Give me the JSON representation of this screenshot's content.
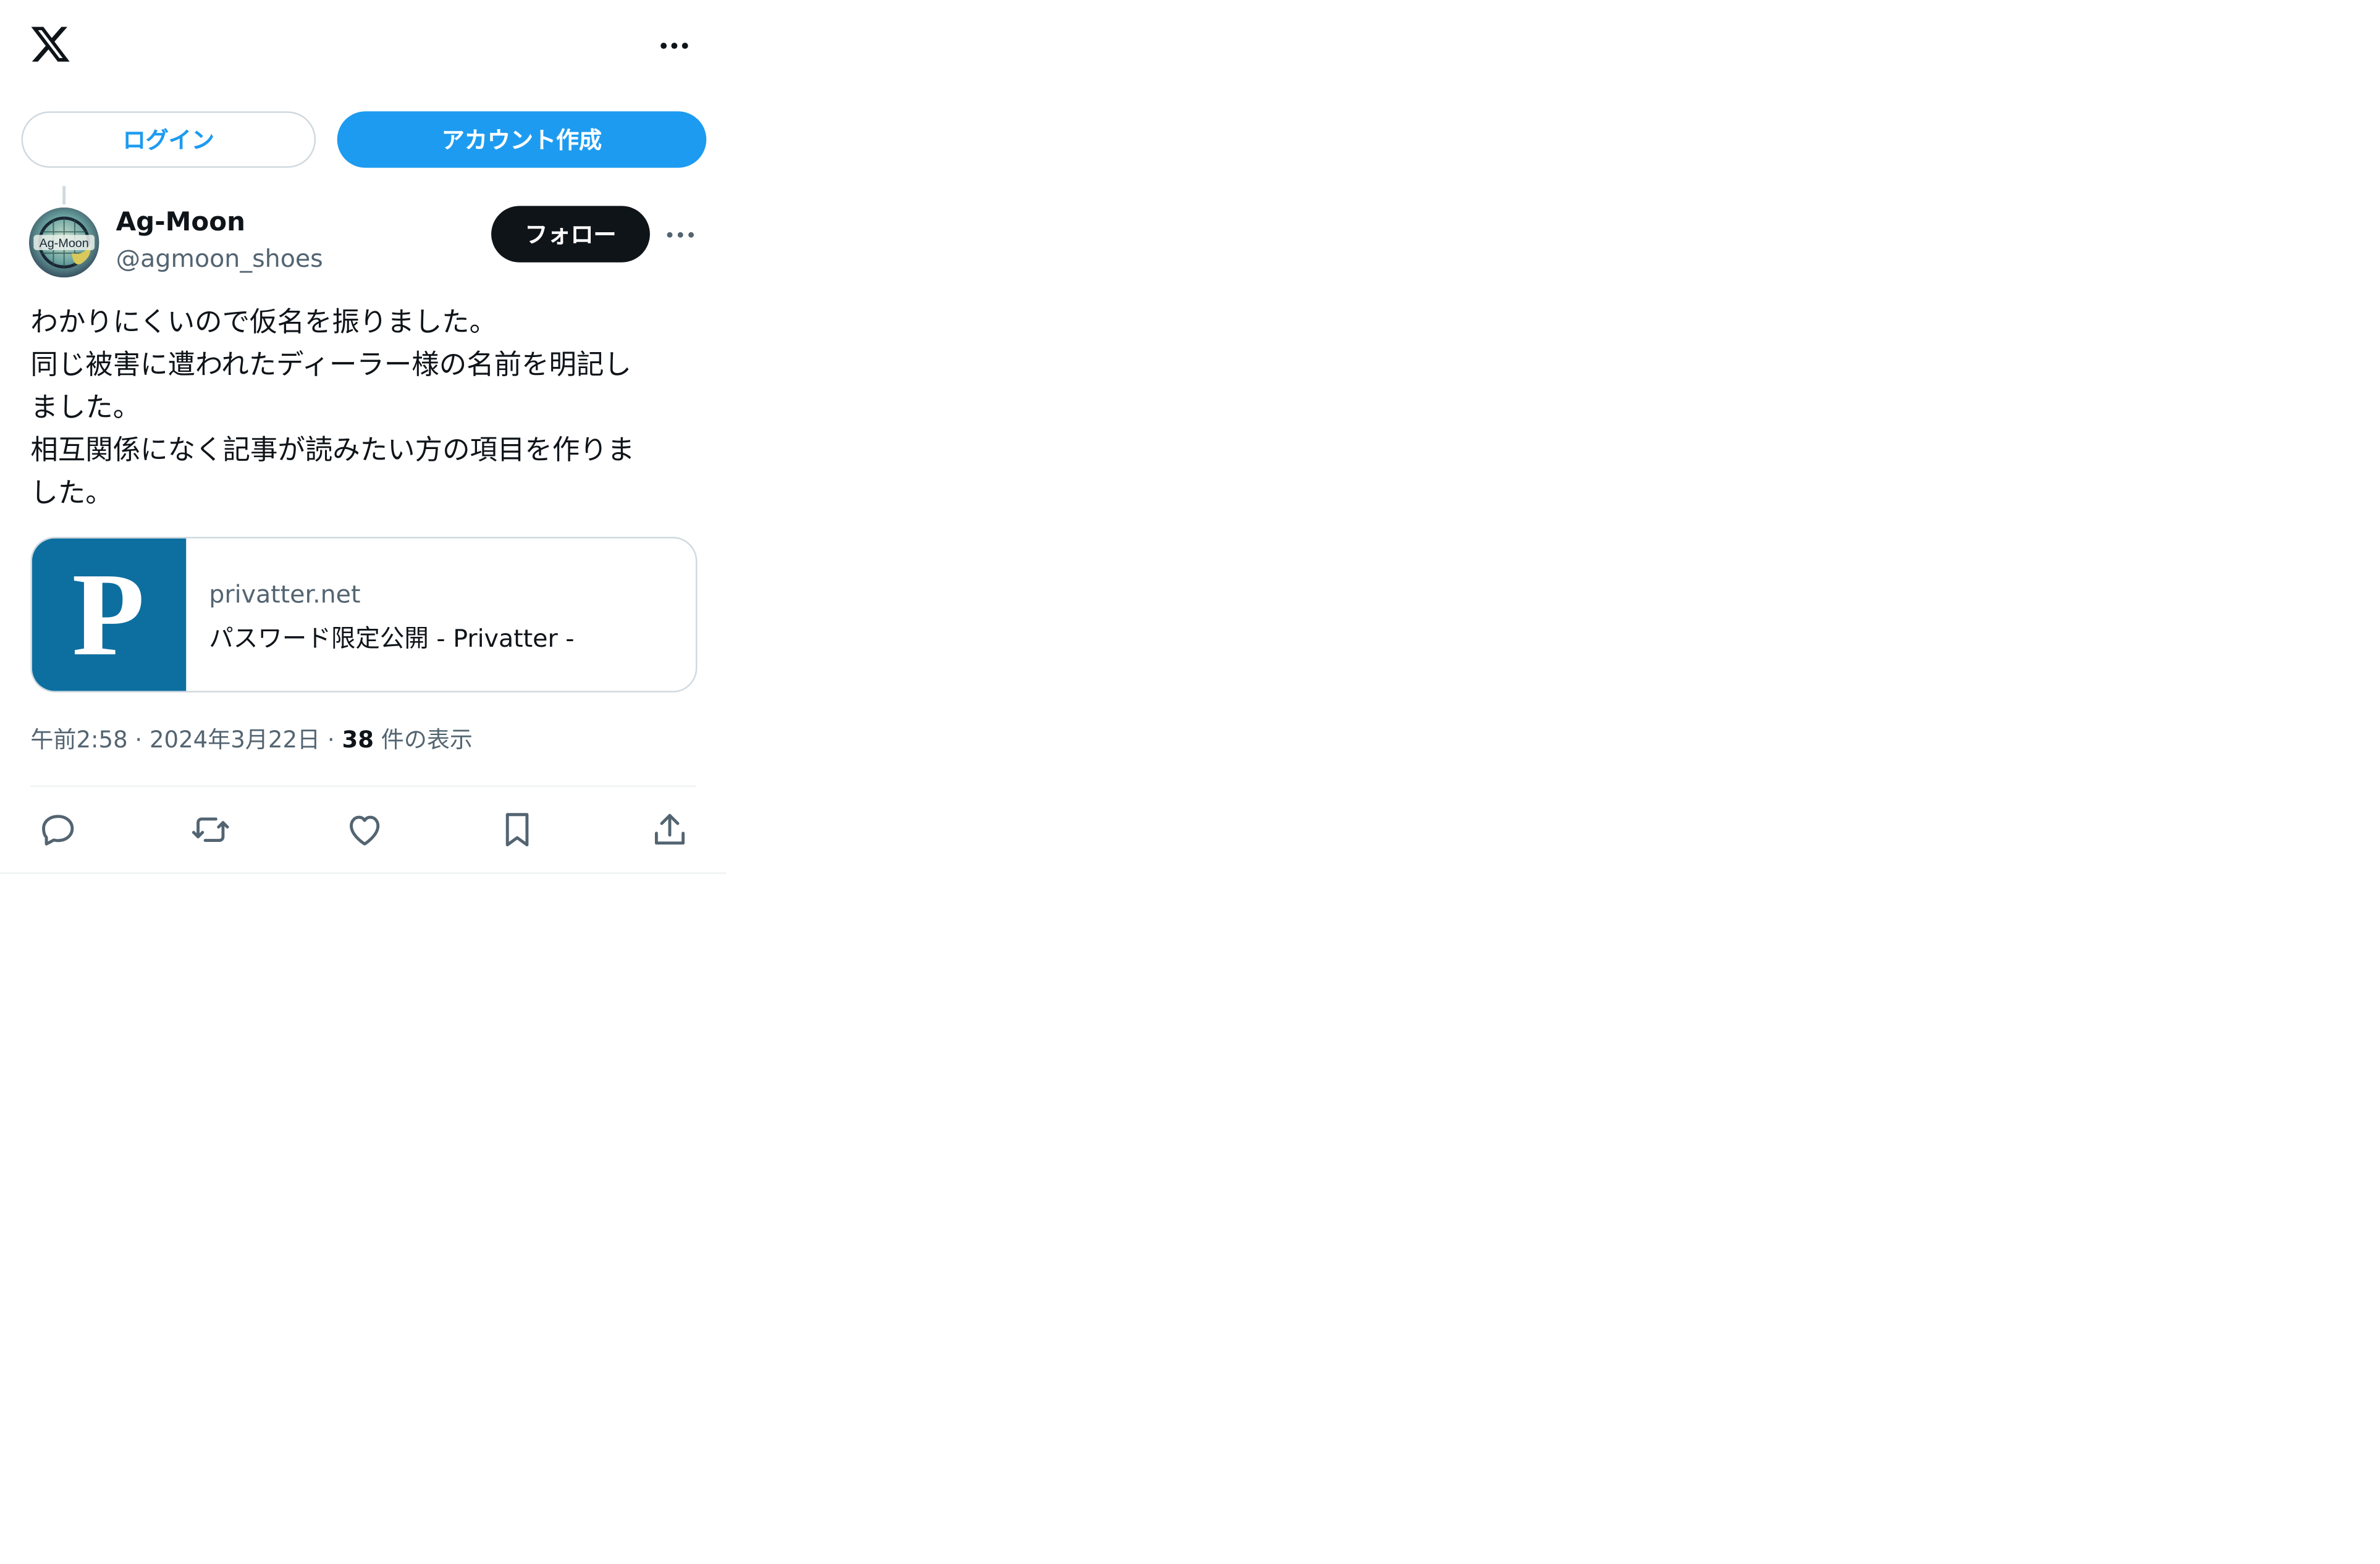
{
  "header": {
    "logo_icon": "x-logo-icon",
    "more_icon": "more-horizontal-icon"
  },
  "auth": {
    "login_label": "ログイン",
    "signup_label": "アカウント作成"
  },
  "tweet": {
    "author": {
      "display_name": "Ag-Moon",
      "handle": "@agmoon_shoes",
      "avatar_text": "Ag-Moon"
    },
    "follow_label": "フォロー",
    "text_lines": [
      "わかりにくいので仮名を振りました。",
      "同じ被害に遭われたディーラー様の名前を明記し",
      "ました。",
      "相互関係になく記事が読みたい方の項目を作りま",
      "した。"
    ],
    "link_card": {
      "thumb_letter": "P",
      "domain": "privatter.net",
      "title": "パスワード限定公開 - Privatter -"
    },
    "meta": {
      "time": "午前2:58",
      "date": "2024年3月22日",
      "separator": "·",
      "views_count": "38",
      "views_label": " 件の表示"
    },
    "actions": [
      "reply-icon",
      "retweet-icon",
      "like-icon",
      "bookmark-icon",
      "share-icon"
    ]
  },
  "colors": {
    "accent": "#1d9bf0",
    "text_primary": "#0f1419",
    "text_secondary": "#536471",
    "border": "#cfd9de",
    "card_thumb": "#0c6fa0"
  }
}
